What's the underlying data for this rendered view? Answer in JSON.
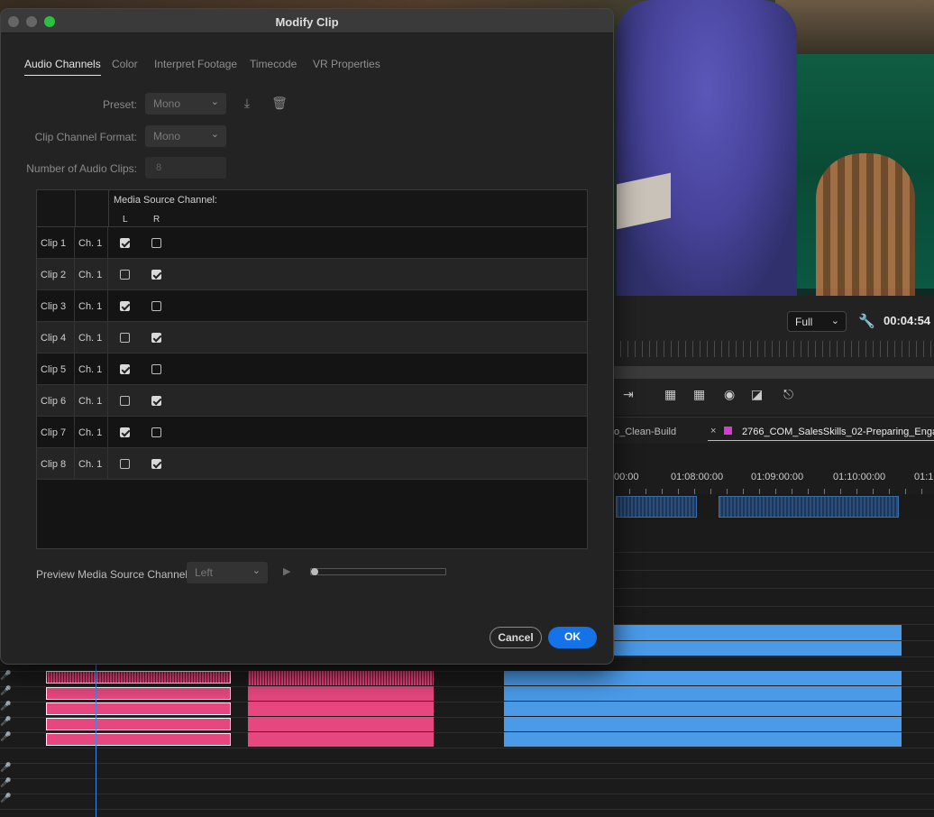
{
  "dialog": {
    "title": "Modify Clip",
    "tabs": [
      {
        "label": "Audio Channels",
        "active": true
      },
      {
        "label": "Color",
        "active": false
      },
      {
        "label": "Interpret Footage",
        "active": false
      },
      {
        "label": "Timecode",
        "active": false
      },
      {
        "label": "VR Properties",
        "active": false
      }
    ],
    "preset": {
      "label": "Preset:",
      "value": "Mono"
    },
    "clip_channel_format": {
      "label": "Clip Channel Format:",
      "value": "Mono"
    },
    "number_of_audio_clips": {
      "label": "Number of Audio Clips:",
      "value": "8"
    },
    "table": {
      "header": "Media Source Channel:",
      "col_left": "L",
      "col_right": "R",
      "rows": [
        {
          "clip": "Clip 1",
          "channel": "Ch. 1",
          "left": true,
          "right": false
        },
        {
          "clip": "Clip 2",
          "channel": "Ch. 1",
          "left": false,
          "right": true
        },
        {
          "clip": "Clip 3",
          "channel": "Ch. 1",
          "left": true,
          "right": false
        },
        {
          "clip": "Clip 4",
          "channel": "Ch. 1",
          "left": false,
          "right": true
        },
        {
          "clip": "Clip 5",
          "channel": "Ch. 1",
          "left": true,
          "right": false
        },
        {
          "clip": "Clip 6",
          "channel": "Ch. 1",
          "left": false,
          "right": true
        },
        {
          "clip": "Clip 7",
          "channel": "Ch. 1",
          "left": true,
          "right": false
        },
        {
          "clip": "Clip 8",
          "channel": "Ch. 1",
          "left": false,
          "right": true
        }
      ]
    },
    "preview": {
      "label": "Preview Media Source Channel:",
      "value": "Left"
    },
    "buttons": {
      "cancel": "Cancel",
      "ok": "OK"
    }
  },
  "program_monitor": {
    "resolution": "Full",
    "timecode": "00:04:54"
  },
  "timeline": {
    "sequence_tab_1": "o_Clean-Build",
    "sequence_tab_2": "2766_COM_SalesSkills_02-Preparing_Engag",
    "ruler_labels": [
      "00:00",
      "01:08:00:00",
      "01:09:00:00",
      "01:10:00:00",
      "01:1"
    ]
  },
  "colors": {
    "accent": "#1473e6",
    "pink_audio": "#e6477e",
    "blue_audio": "#4a9ae8",
    "sequence_label": "#d23fd0"
  }
}
